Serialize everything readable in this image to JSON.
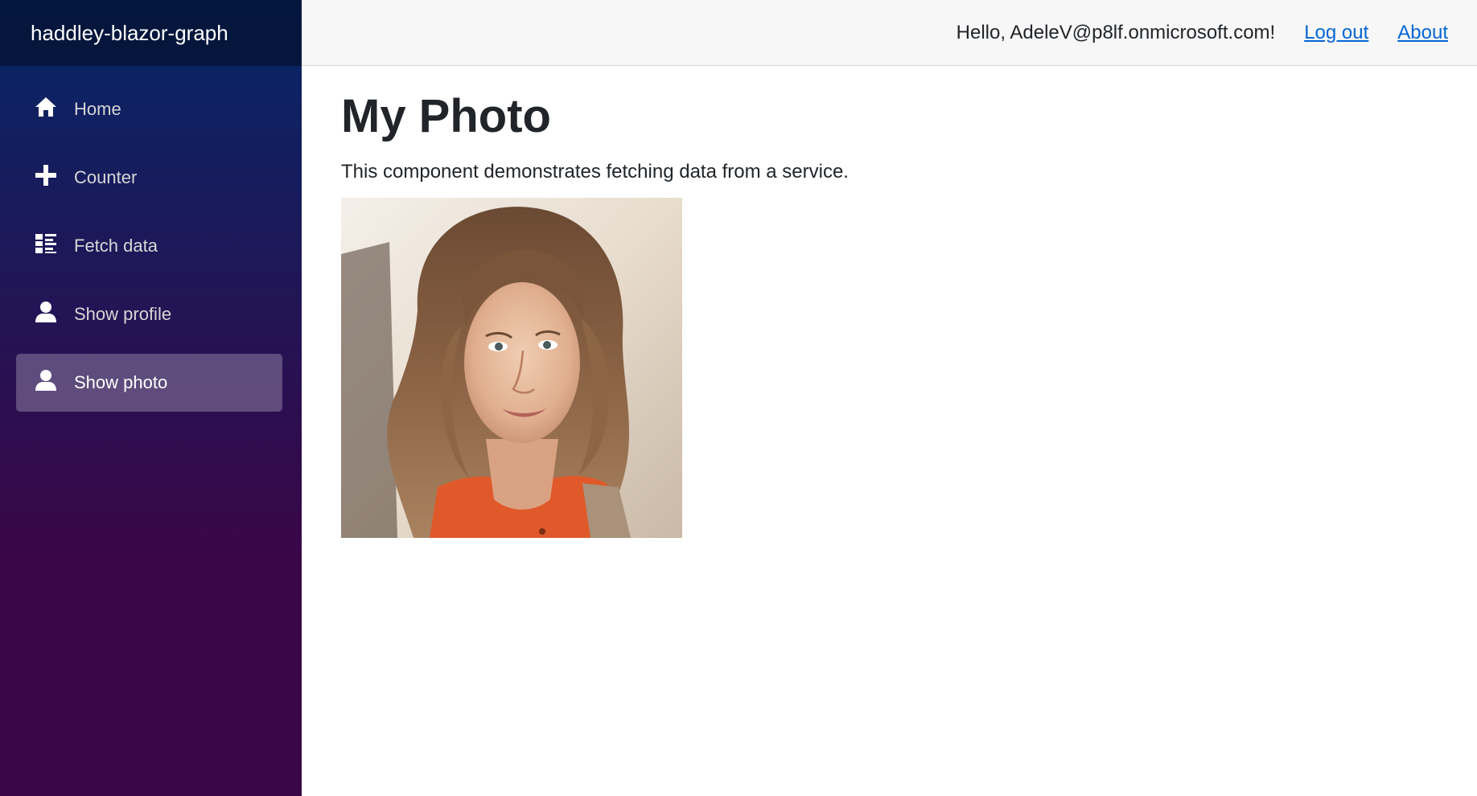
{
  "app": {
    "brand": "haddley-blazor-graph"
  },
  "sidebar": {
    "items": [
      {
        "label": "Home",
        "icon": "home-icon",
        "active": false
      },
      {
        "label": "Counter",
        "icon": "plus-icon",
        "active": false
      },
      {
        "label": "Fetch data",
        "icon": "list-icon",
        "active": false
      },
      {
        "label": "Show profile",
        "icon": "person-icon",
        "active": false
      },
      {
        "label": "Show photo",
        "icon": "person-icon",
        "active": true
      }
    ]
  },
  "header": {
    "greeting": "Hello, AdeleV@p8lf.onmicrosoft.com!",
    "logout_label": "Log out",
    "about_label": "About"
  },
  "main": {
    "title": "My Photo",
    "description": "This component demonstrates fetching data from a service.",
    "photo_icon": "user-photo"
  },
  "colors": {
    "sidebar_top": "#052767",
    "sidebar_bottom": "#3a0647",
    "link": "#0366d6",
    "top_row_bg": "#f7f7f7",
    "text": "#212529"
  }
}
